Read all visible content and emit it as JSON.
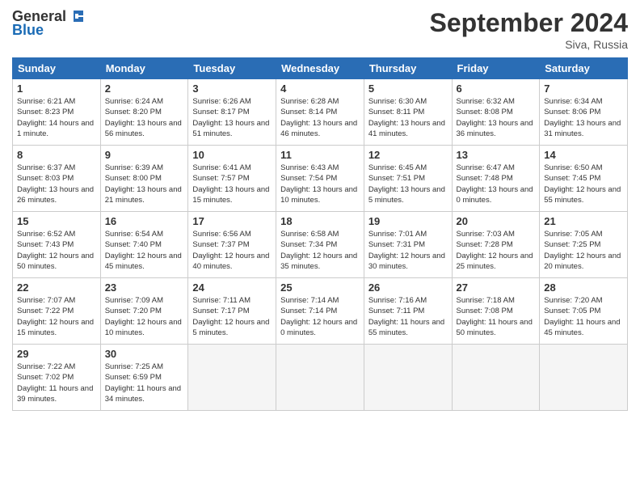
{
  "header": {
    "logo_general": "General",
    "logo_blue": "Blue",
    "month_title": "September 2024",
    "location": "Siva, Russia"
  },
  "days_of_week": [
    "Sunday",
    "Monday",
    "Tuesday",
    "Wednesday",
    "Thursday",
    "Friday",
    "Saturday"
  ],
  "weeks": [
    [
      {
        "day": "1",
        "sunrise": "6:21 AM",
        "sunset": "8:23 PM",
        "daylight": "Daylight: 14 hours and 1 minute."
      },
      {
        "day": "2",
        "sunrise": "6:24 AM",
        "sunset": "8:20 PM",
        "daylight": "Daylight: 13 hours and 56 minutes."
      },
      {
        "day": "3",
        "sunrise": "6:26 AM",
        "sunset": "8:17 PM",
        "daylight": "Daylight: 13 hours and 51 minutes."
      },
      {
        "day": "4",
        "sunrise": "6:28 AM",
        "sunset": "8:14 PM",
        "daylight": "Daylight: 13 hours and 46 minutes."
      },
      {
        "day": "5",
        "sunrise": "6:30 AM",
        "sunset": "8:11 PM",
        "daylight": "Daylight: 13 hours and 41 minutes."
      },
      {
        "day": "6",
        "sunrise": "6:32 AM",
        "sunset": "8:08 PM",
        "daylight": "Daylight: 13 hours and 36 minutes."
      },
      {
        "day": "7",
        "sunrise": "6:34 AM",
        "sunset": "8:06 PM",
        "daylight": "Daylight: 13 hours and 31 minutes."
      }
    ],
    [
      {
        "day": "8",
        "sunrise": "6:37 AM",
        "sunset": "8:03 PM",
        "daylight": "Daylight: 13 hours and 26 minutes."
      },
      {
        "day": "9",
        "sunrise": "6:39 AM",
        "sunset": "8:00 PM",
        "daylight": "Daylight: 13 hours and 21 minutes."
      },
      {
        "day": "10",
        "sunrise": "6:41 AM",
        "sunset": "7:57 PM",
        "daylight": "Daylight: 13 hours and 15 minutes."
      },
      {
        "day": "11",
        "sunrise": "6:43 AM",
        "sunset": "7:54 PM",
        "daylight": "Daylight: 13 hours and 10 minutes."
      },
      {
        "day": "12",
        "sunrise": "6:45 AM",
        "sunset": "7:51 PM",
        "daylight": "Daylight: 13 hours and 5 minutes."
      },
      {
        "day": "13",
        "sunrise": "6:47 AM",
        "sunset": "7:48 PM",
        "daylight": "Daylight: 13 hours and 0 minutes."
      },
      {
        "day": "14",
        "sunrise": "6:50 AM",
        "sunset": "7:45 PM",
        "daylight": "Daylight: 12 hours and 55 minutes."
      }
    ],
    [
      {
        "day": "15",
        "sunrise": "6:52 AM",
        "sunset": "7:43 PM",
        "daylight": "Daylight: 12 hours and 50 minutes."
      },
      {
        "day": "16",
        "sunrise": "6:54 AM",
        "sunset": "7:40 PM",
        "daylight": "Daylight: 12 hours and 45 minutes."
      },
      {
        "day": "17",
        "sunrise": "6:56 AM",
        "sunset": "7:37 PM",
        "daylight": "Daylight: 12 hours and 40 minutes."
      },
      {
        "day": "18",
        "sunrise": "6:58 AM",
        "sunset": "7:34 PM",
        "daylight": "Daylight: 12 hours and 35 minutes."
      },
      {
        "day": "19",
        "sunrise": "7:01 AM",
        "sunset": "7:31 PM",
        "daylight": "Daylight: 12 hours and 30 minutes."
      },
      {
        "day": "20",
        "sunrise": "7:03 AM",
        "sunset": "7:28 PM",
        "daylight": "Daylight: 12 hours and 25 minutes."
      },
      {
        "day": "21",
        "sunrise": "7:05 AM",
        "sunset": "7:25 PM",
        "daylight": "Daylight: 12 hours and 20 minutes."
      }
    ],
    [
      {
        "day": "22",
        "sunrise": "7:07 AM",
        "sunset": "7:22 PM",
        "daylight": "Daylight: 12 hours and 15 minutes."
      },
      {
        "day": "23",
        "sunrise": "7:09 AM",
        "sunset": "7:20 PM",
        "daylight": "Daylight: 12 hours and 10 minutes."
      },
      {
        "day": "24",
        "sunrise": "7:11 AM",
        "sunset": "7:17 PM",
        "daylight": "Daylight: 12 hours and 5 minutes."
      },
      {
        "day": "25",
        "sunrise": "7:14 AM",
        "sunset": "7:14 PM",
        "daylight": "Daylight: 12 hours and 0 minutes."
      },
      {
        "day": "26",
        "sunrise": "7:16 AM",
        "sunset": "7:11 PM",
        "daylight": "Daylight: 11 hours and 55 minutes."
      },
      {
        "day": "27",
        "sunrise": "7:18 AM",
        "sunset": "7:08 PM",
        "daylight": "Daylight: 11 hours and 50 minutes."
      },
      {
        "day": "28",
        "sunrise": "7:20 AM",
        "sunset": "7:05 PM",
        "daylight": "Daylight: 11 hours and 45 minutes."
      }
    ],
    [
      {
        "day": "29",
        "sunrise": "7:22 AM",
        "sunset": "7:02 PM",
        "daylight": "Daylight: 11 hours and 39 minutes."
      },
      {
        "day": "30",
        "sunrise": "7:25 AM",
        "sunset": "6:59 PM",
        "daylight": "Daylight: 11 hours and 34 minutes."
      },
      null,
      null,
      null,
      null,
      null
    ]
  ]
}
